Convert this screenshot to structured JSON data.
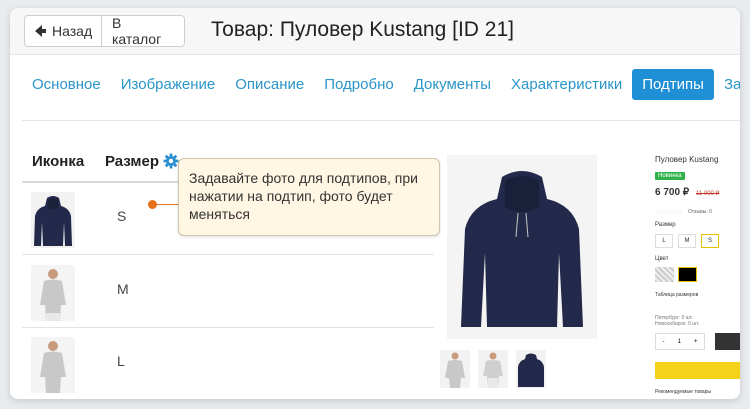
{
  "header": {
    "back_label": "Назад",
    "catalog_label": "В каталог",
    "title": "Товар: Пуловер Kustang [ID 21]"
  },
  "tabs": [
    {
      "label": "Основное",
      "active": false
    },
    {
      "label": "Изображение",
      "active": false
    },
    {
      "label": "Описание",
      "active": false
    },
    {
      "label": "Подробно",
      "active": false
    },
    {
      "label": "Документы",
      "active": false
    },
    {
      "label": "Характеристики",
      "active": false
    },
    {
      "label": "Подтипы",
      "active": true
    },
    {
      "label": "Заг",
      "active": false
    }
  ],
  "table": {
    "col_icon": "Иконка",
    "col_size": "Размер",
    "rows": [
      {
        "size": "S",
        "image": "navy-hoodie"
      },
      {
        "size": "M",
        "image": "grey-sweater-model"
      },
      {
        "size": "L",
        "image": "grey-sweater-model"
      }
    ]
  },
  "tooltip": {
    "text": "Задавайте фото для подтипов, при нажатии на подтип, фото будет меняться"
  },
  "preview": {
    "product_title": "Пуловер Kustang",
    "badge": "Новинка",
    "price": "6 700 ₽",
    "old_price": "11 000 ₽",
    "stars": "☆☆☆☆☆",
    "reviews": "Отзывы: 0",
    "size_label": "Размер",
    "sizes": [
      "L",
      "M",
      "S"
    ],
    "selected_size": "S",
    "color_label": "Цвет",
    "size_table": "Таблица размеров",
    "stock_1": "Петербург: 0 шт.",
    "stock_2": "Новосибирск: 0 шт.",
    "qty_minus": "-",
    "qty_value": "1",
    "qty_plus": "+",
    "recommended": "Рекомендуемые товары"
  },
  "colors": {
    "accent": "#1f8fd6",
    "link": "#2b95c9",
    "tooltip_bg": "#fff6e3",
    "dot": "#e8701b",
    "badge": "#2fb24a",
    "buy": "#f5d21a",
    "hoodie": "#23294a"
  }
}
